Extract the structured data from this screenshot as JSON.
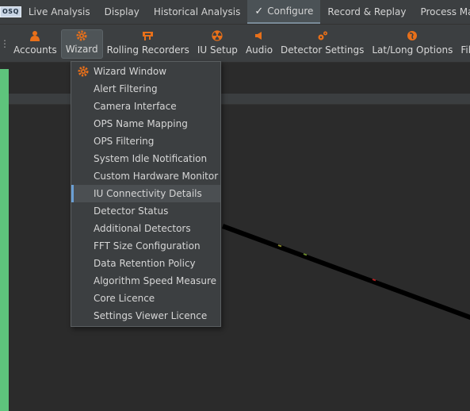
{
  "app": {
    "logo_text": "OSQ"
  },
  "menubar": {
    "items": [
      {
        "label": "Live Analysis"
      },
      {
        "label": "Display"
      },
      {
        "label": "Historical Analysis"
      },
      {
        "label": "Configure",
        "active": true
      },
      {
        "label": "Record & Replay"
      },
      {
        "label": "Process Management"
      }
    ]
  },
  "toolbar": {
    "buttons": [
      {
        "label": "Accounts",
        "icon": "accounts-icon"
      },
      {
        "label": "Wizard",
        "icon": "gear-icon"
      },
      {
        "label": "Rolling Recorders",
        "icon": "recorder-icon"
      },
      {
        "label": "IU Setup",
        "icon": "radiation-icon"
      },
      {
        "label": "Audio",
        "icon": "speaker-icon"
      },
      {
        "label": "Detector Settings",
        "icon": "detector-gears-icon"
      },
      {
        "label": "Lat/Long Options",
        "icon": "globe-icon"
      },
      {
        "label": "Fibre Routes",
        "icon": "fibre-route-icon"
      }
    ]
  },
  "wizard_menu": {
    "items": [
      {
        "label": "Wizard Window",
        "icon": "gear-icon"
      },
      {
        "label": "Alert Filtering"
      },
      {
        "label": "Camera Interface"
      },
      {
        "label": "OPS Name Mapping"
      },
      {
        "label": "OPS Filtering"
      },
      {
        "label": "System Idle Notification"
      },
      {
        "label": "Custom Hardware Monitor"
      },
      {
        "label": "IU Connectivity Details",
        "selected": true
      },
      {
        "label": "Detector Status"
      },
      {
        "label": "Additional Detectors"
      },
      {
        "label": "FFT Size Configuration"
      },
      {
        "label": "Data Retention Policy"
      },
      {
        "label": "Algorithm Speed Measure"
      },
      {
        "label": "Core Licence"
      },
      {
        "label": "Settings Viewer Licence"
      }
    ]
  },
  "colors": {
    "accent_orange": "#e8701a",
    "left_stripe": "#5ec47c",
    "selection_marker": "#6a9fd4"
  }
}
